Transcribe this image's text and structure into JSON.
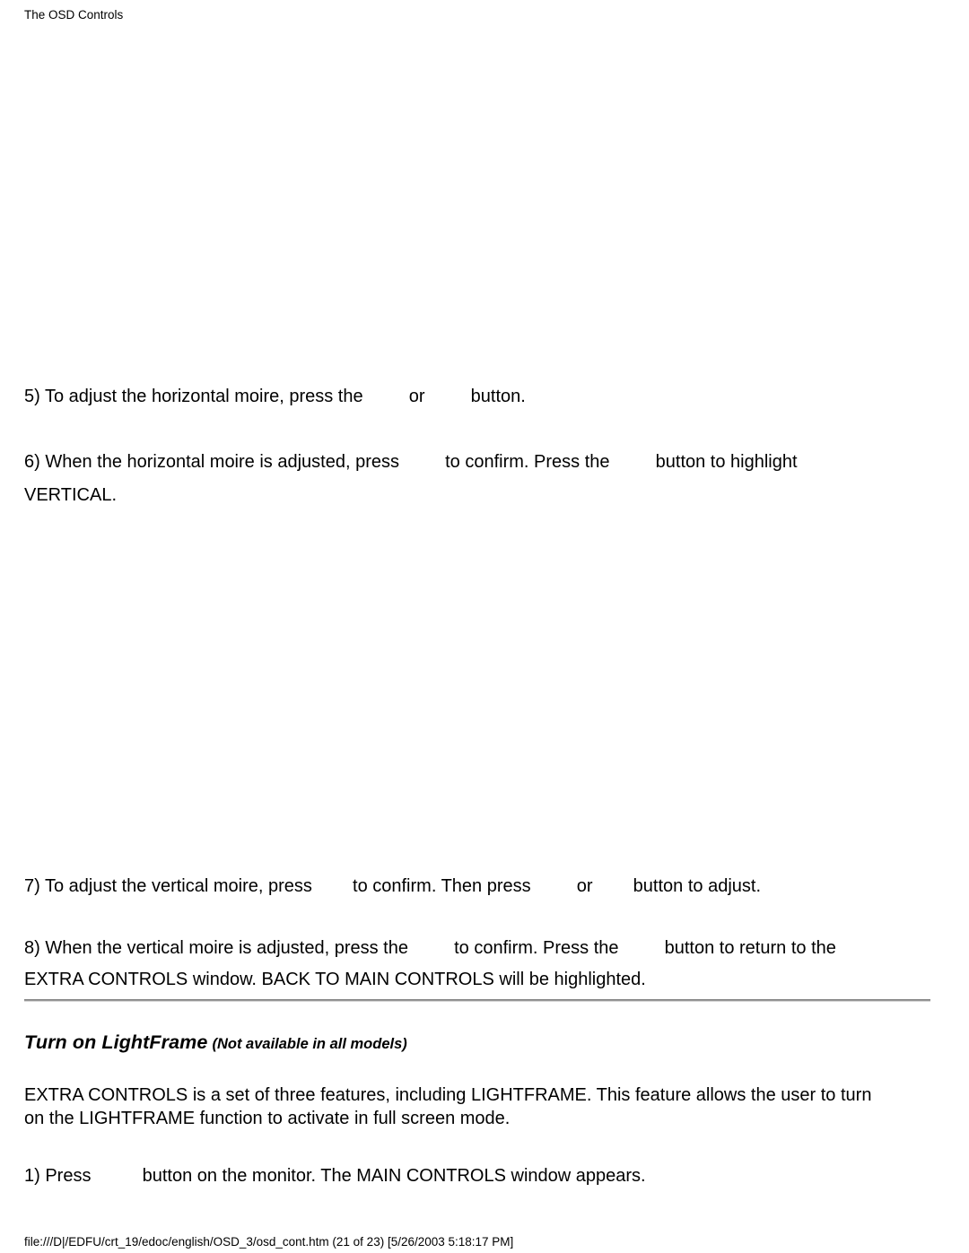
{
  "header": {
    "title": "The OSD Controls"
  },
  "figures": [
    {
      "name": "osd-horizontal-moire",
      "alt": ""
    },
    {
      "name": "osd-vertical-select",
      "alt": ""
    }
  ],
  "steps": {
    "step_5": {
      "part_1": "5) To adjust the horizontal moire, press the",
      "part_2": "or",
      "part_3": "button."
    },
    "step_6": {
      "part_1": "6) When the horizontal moire is adjusted, press",
      "part_2": "to confirm. Press the",
      "part_3": "button to highlight",
      "line_2": "VERTICAL."
    },
    "step_7": {
      "part_1": "7) To adjust the vertical moire, press",
      "part_2": "to confirm. Then press",
      "part_3": "or",
      "part_4": "button to adjust."
    },
    "step_8": {
      "part_1": "8) When the vertical moire is adjusted, press the",
      "part_2": "to confirm. Press the",
      "part_3": "button to return to the",
      "line_2": "EXTRA CONTROLS window. BACK TO MAIN CONTROLS will be highlighted."
    }
  },
  "lightframe_section": {
    "heading_main": "Turn on LightFrame",
    "heading_note": "(Not available in all models)",
    "intro_line_1": "EXTRA CONTROLS is a set of three features, including LIGHTFRAME. This feature allows the user to turn",
    "intro_line_2": "on the LIGHTFRAME function to activate in full screen mode.",
    "step_1": {
      "part_1": "1) Press",
      "part_2": "button on the monitor. The MAIN CONTROLS window appears."
    }
  },
  "footer": {
    "path": "file:///D|/EDFU/crt_19/edoc/english/OSD_3/osd_cont.htm (21 of 23) [5/26/2003 5:18:17 PM]"
  },
  "colors": {
    "background": "#ffffff",
    "text": "#000000",
    "divider_dark": "#808080",
    "divider_light": "#d9d9d9"
  }
}
